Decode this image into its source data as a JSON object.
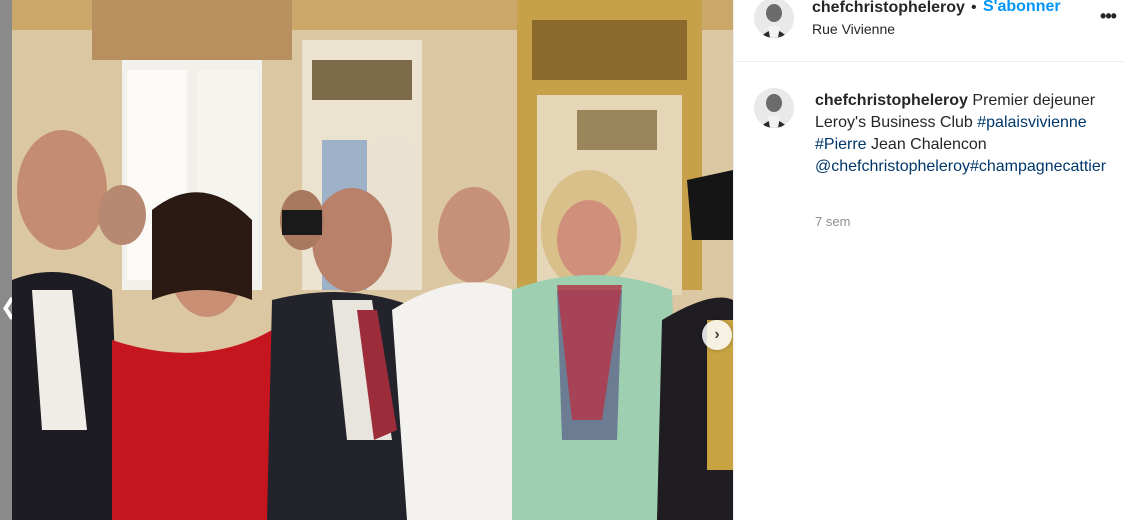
{
  "post": {
    "username": "chefchristopheleroy",
    "separator": "•",
    "follow_label": "S'abonner",
    "location": "Rue Vivienne",
    "more_icon": "more-horizontal-icon",
    "more_glyph": "•••"
  },
  "caption": {
    "author": "chefchristopheleroy",
    "text_1": "Premier dejeuner Leroy's Business Club",
    "tag_1": "#palaisvivienne",
    "tag_2": "#Pierre",
    "text_2": "Jean Chalencon",
    "mention": "@chefchristopheleroy",
    "tag_3": "#champagnecattier",
    "time": "7 sem"
  },
  "carousel": {
    "next_glyph": "›",
    "prev_glyph": "❮"
  },
  "colors": {
    "link_blue": "#0095f6",
    "hashtag_blue": "#00376b",
    "muted": "#8e8e8e"
  }
}
